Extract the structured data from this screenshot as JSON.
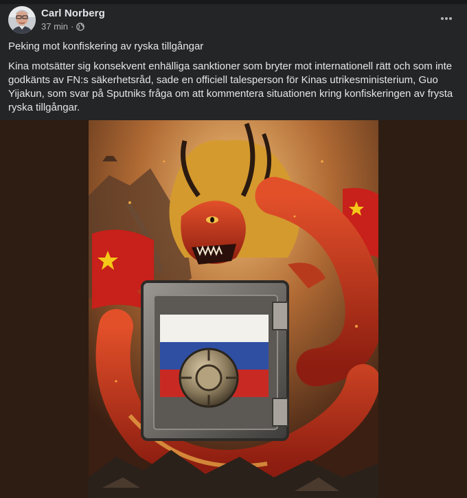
{
  "post": {
    "author": "Carl Norberg",
    "time": "37 min",
    "separator": "·",
    "privacy_icon": "globe-icon",
    "more_icon": "ellipsis-icon",
    "headline": "Peking mot konfiskering av ryska tillgångar",
    "body": "Kina motsätter sig konsekvent enhälliga sanktioner som bryter mot internationell rätt och som inte godkänts av FN:s säkerhetsråd, sade en officiell talesperson för Kinas utrikesministerium, Guo Yijakun, som svar på Sputniks fråga om att kommentera situationen kring konfiskeringen av frysta ryska tillgångar.",
    "image": {
      "description_icon": "dragon-safe-illustration"
    }
  },
  "colors": {
    "background": "#242526",
    "text_primary": "#e4e6eb",
    "text_secondary": "#b0b3b8",
    "media_letterbox": "#2d1d12"
  }
}
